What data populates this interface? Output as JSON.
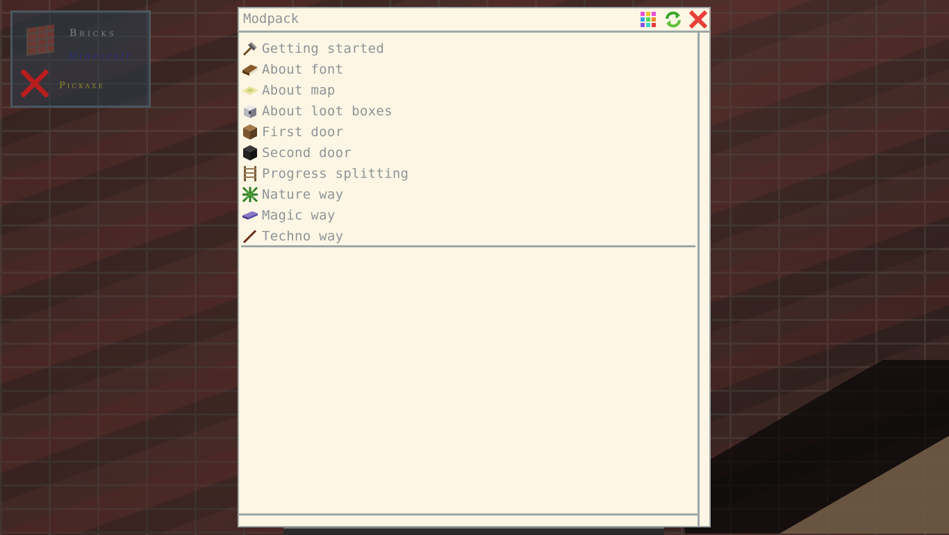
{
  "hud": {
    "block_name": "Bricks",
    "mod_name": "Minecraft",
    "tool_name": "Pickaxe",
    "brick_icon": "bricks-block-icon",
    "tool_status_icon": "red-x-icon"
  },
  "window": {
    "title": "Modpack",
    "buttons": [
      {
        "icon": "grid-icon",
        "label": "grid"
      },
      {
        "icon": "refresh-icon",
        "label": "refresh"
      },
      {
        "icon": "close-icon",
        "label": "close"
      }
    ]
  },
  "quests": [
    {
      "label": "Getting started",
      "icon": "hammer-icon"
    },
    {
      "label": "About font",
      "icon": "book-icon"
    },
    {
      "label": "About map",
      "icon": "map-icon"
    },
    {
      "label": "About loot boxes",
      "icon": "lootbox-icon"
    },
    {
      "label": "First door",
      "icon": "wooden-block-icon"
    },
    {
      "label": "Second door",
      "icon": "dark-block-icon"
    },
    {
      "label": "Progress splitting",
      "icon": "ladder-icon"
    },
    {
      "label": "Nature way",
      "icon": "vine-icon"
    },
    {
      "label": "Magic way",
      "icon": "magic-ingot-icon"
    },
    {
      "label": "Techno way",
      "icon": "stick-icon"
    }
  ],
  "colors": {
    "window_bg": "#fdf6e4",
    "border": "#9ea8a6",
    "text": "#8d9597",
    "close": "#e8403a",
    "refresh": "#3aa52a"
  }
}
